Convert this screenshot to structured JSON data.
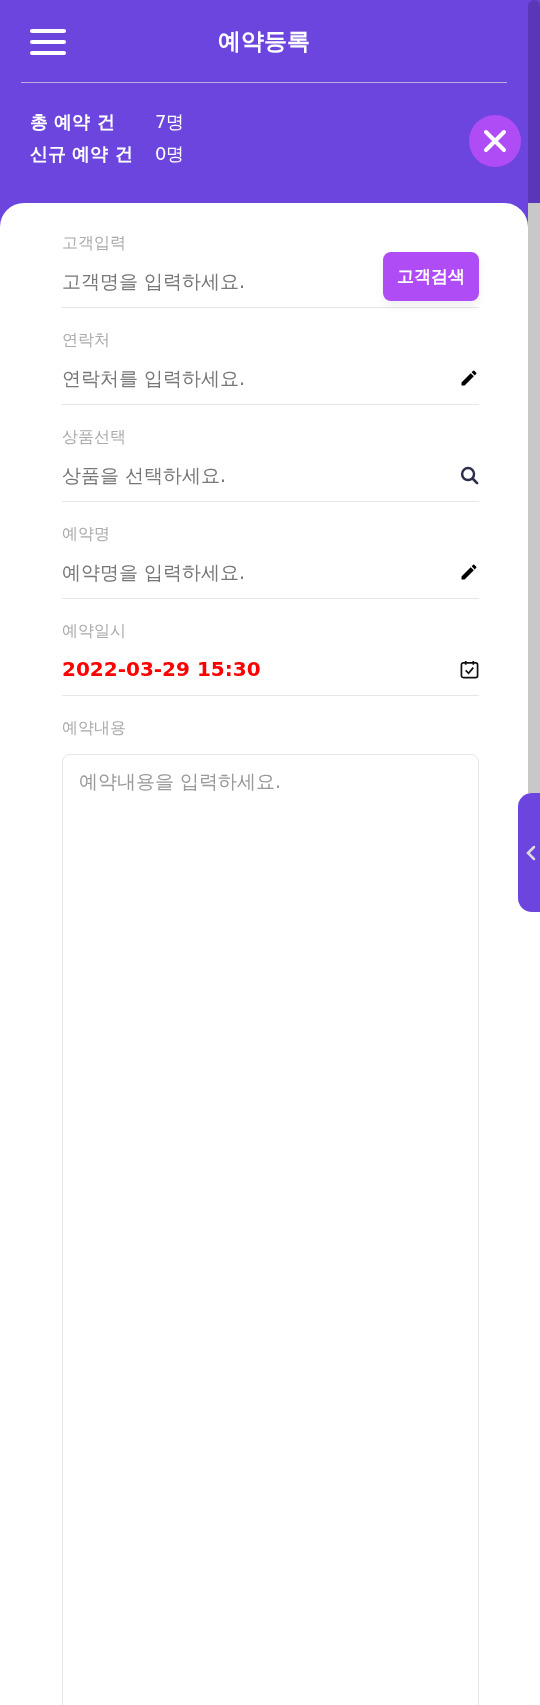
{
  "header": {
    "title": "예약등록"
  },
  "stats": [
    {
      "label": "총 예약 건",
      "value": "7명"
    },
    {
      "label": "신규 예약 건",
      "value": "0명"
    }
  ],
  "fields": [
    {
      "kind": "search_button",
      "label": "고객입력",
      "placeholder": "고객명을 입력하세요.",
      "button": "고객검색"
    },
    {
      "kind": "edit",
      "label": "연락처",
      "placeholder": "연락처를 입력하세요."
    },
    {
      "kind": "search",
      "label": "상품선택",
      "placeholder": "상품을 선택하세요."
    },
    {
      "kind": "edit",
      "label": "예약명",
      "placeholder": "예약명을 입력하세요."
    },
    {
      "kind": "date",
      "label": "예약일시",
      "value": "2022-03-29 15:30"
    },
    {
      "kind": "textarea",
      "label": "예약내용",
      "placeholder": "예약내용을 입력하세요."
    }
  ]
}
